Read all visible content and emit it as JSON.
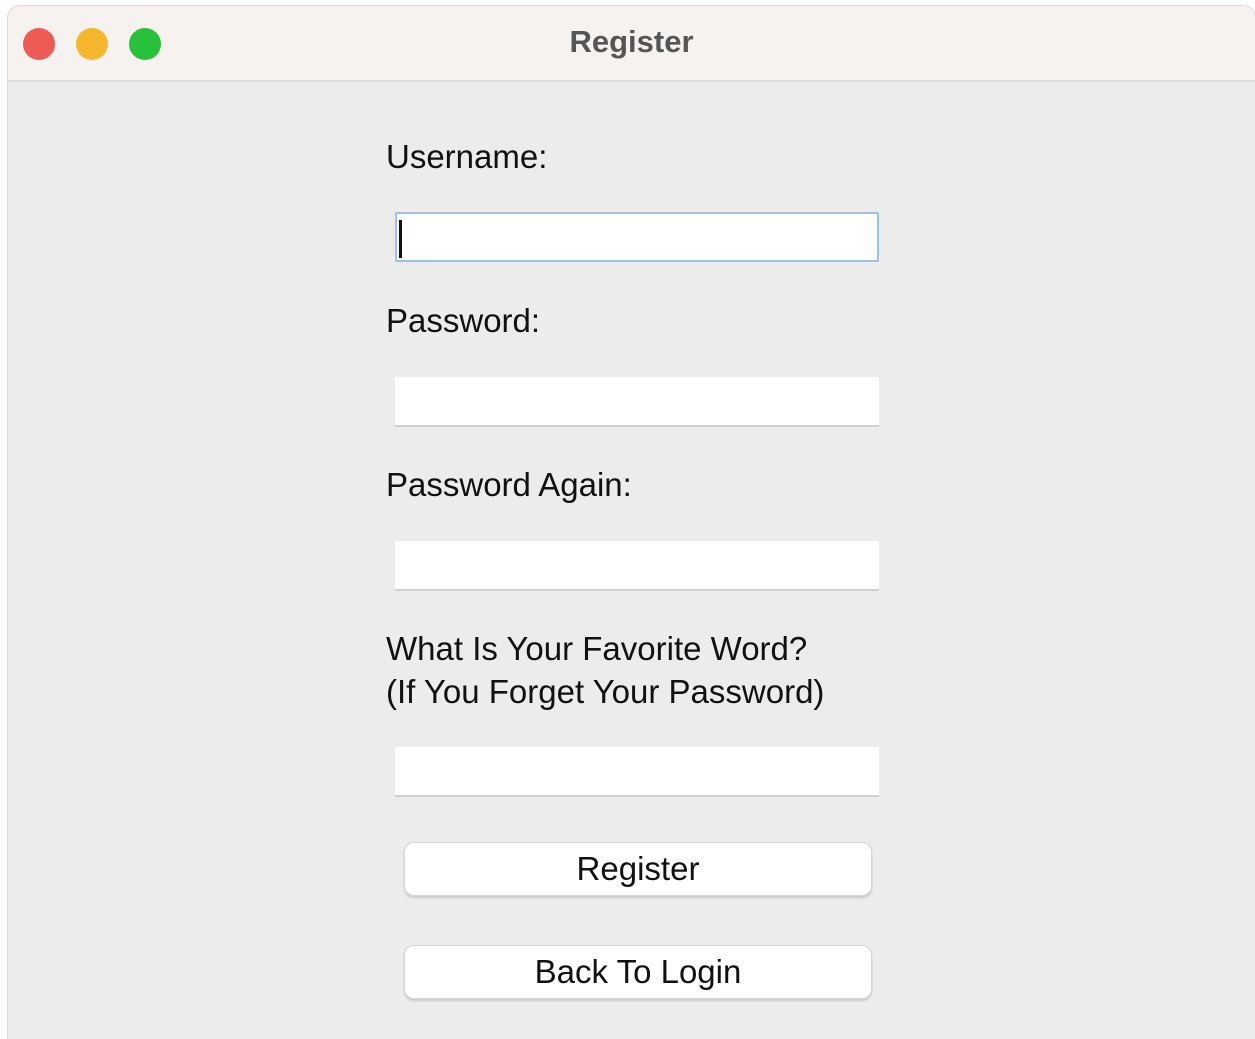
{
  "window": {
    "title": "Register",
    "controls": [
      "close",
      "minimize",
      "zoom"
    ],
    "colors": {
      "close": "#ee5b55",
      "minimize": "#f6b72f",
      "zoom": "#28c13b",
      "background": "#ececec"
    }
  },
  "form": {
    "username_label": "Username:",
    "username_value": "",
    "password_label": "Password:",
    "password_value": "",
    "password_again_label": "Password Again:",
    "password_again_value": "",
    "favorite_word_label_line1": "What Is Your Favorite Word?",
    "favorite_word_label_line2": "(If You Forget Your Password)",
    "favorite_word_value": ""
  },
  "buttons": {
    "register_label": "Register",
    "back_to_login_label": "Back To Login"
  }
}
